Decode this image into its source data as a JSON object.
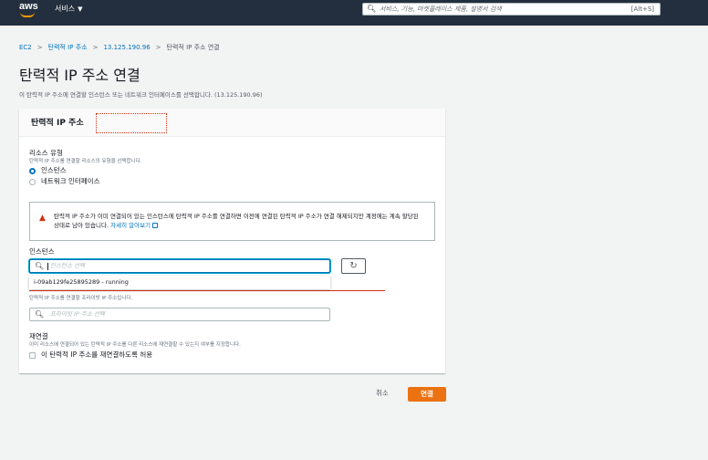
{
  "topnav": {
    "logo": "aws",
    "services_label": "서비스",
    "search_placeholder": "서비스, 기능, 마켓플레이스 제품, 설명서 검색",
    "search_shortcut": "[Alt+S]"
  },
  "breadcrumb": {
    "items": [
      "EC2",
      "탄력적 IP 주소",
      "13.125.190.96",
      "탄력적 IP 주소 연결"
    ]
  },
  "page": {
    "title": "탄력적 IP 주소 연결",
    "description": "이 탄력적 IP 주소에 연결할 인스턴스 또는 네트워크 인터페이스를 선택합니다. (13.125.190.96)"
  },
  "panel": {
    "title": "탄력적 IP 주소"
  },
  "resource_type": {
    "label": "리소스 유형",
    "description": "탄력적 IP 주소를 연결할 리소스의 유형을 선택합니다.",
    "options": [
      {
        "label": "인스턴스",
        "selected": true
      },
      {
        "label": "네트워크 인터페이스",
        "selected": false
      }
    ]
  },
  "alert": {
    "message": "탄력적 IP 주소가 이미 연결되어 있는 인스턴스에 탄력적 IP 주소를 연결하면 이전에 연결된 탄력적 IP 주소가 연결 해제되지만 계정에는 계속 할당된 상태로 남아 있습니다.",
    "link": "자세히 알아보기"
  },
  "instance": {
    "label": "인스턴스",
    "placeholder": "인스턴스 선택",
    "dropdown_option": "i-09ab129fe25895289 - running"
  },
  "private_ip": {
    "description": "탄력적 IP 주소를 연결할 프라이빗 IP 주소입니다.",
    "placeholder": "프라이빗 IP 주소 선택"
  },
  "reassociate": {
    "label": "재연결",
    "description": "이미 리소스에 연결되어 있는 탄력적 IP 주소를 다른 리소스에 재연결할 수 있는지 여부를 지정합니다.",
    "checkbox_label": "이 탄력적 IP 주소를 재연결하도록 허용",
    "checked": false
  },
  "actions": {
    "cancel": "취소",
    "connect": "연결"
  },
  "colors": {
    "nav_bg": "#232f3e",
    "primary_button": "#ec7211",
    "link": "#0073bb",
    "annotation_red": "#d13212"
  },
  "icons": {
    "search": "search-icon",
    "refresh": "refresh-icon",
    "warning": "warning-icon",
    "external": "external-link-icon"
  }
}
